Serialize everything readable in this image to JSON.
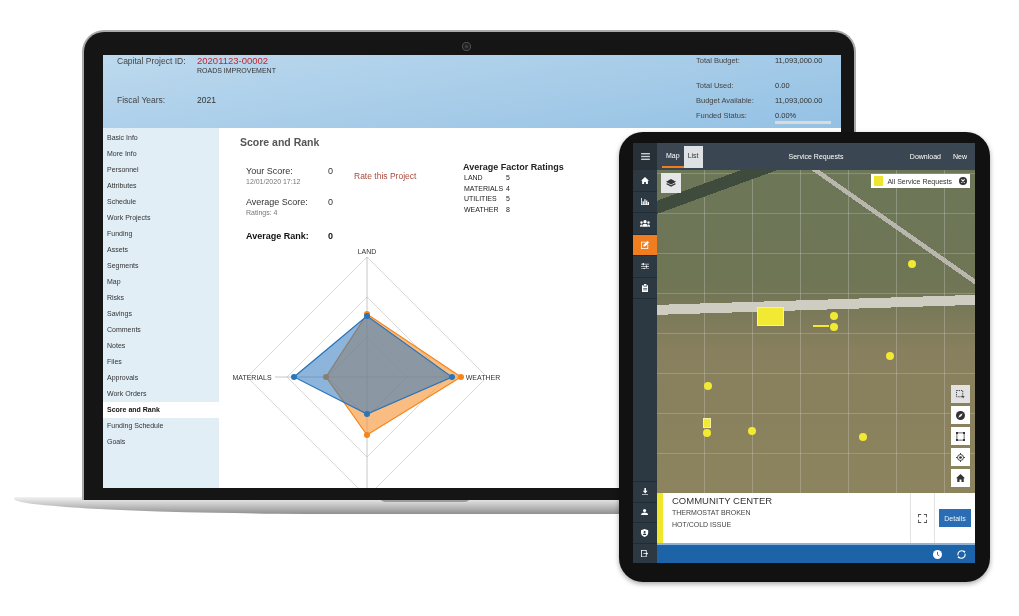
{
  "laptop": {
    "header": {
      "project_id_label": "Capital Project ID:",
      "project_id": "20201123-00002",
      "project_name": "ROADS IMPROVEMENT",
      "fiscal_years_label": "Fiscal Years:",
      "fiscal_years": "2021",
      "budget": [
        {
          "label": "Total Budget:",
          "value": "11,093,000.00"
        },
        {
          "label": "Total Used:",
          "value": "0.00"
        },
        {
          "label": "Budget Available:",
          "value": "11,093,000.00"
        },
        {
          "label": "Funded Status:",
          "value": "0.00%"
        }
      ],
      "funded_bar": {
        "level": 0
      }
    },
    "sidebar": {
      "items": [
        {
          "label": "Basic Info",
          "selected": false
        },
        {
          "label": "More Info",
          "selected": false
        },
        {
          "label": "Personnel",
          "selected": false
        },
        {
          "label": "Attributes",
          "selected": false
        },
        {
          "label": "Schedule",
          "selected": false
        },
        {
          "label": "Work Projects",
          "selected": false
        },
        {
          "label": "Funding",
          "selected": false
        },
        {
          "label": "Assets",
          "selected": false
        },
        {
          "label": "Segments",
          "selected": false
        },
        {
          "label": "Map",
          "selected": false
        },
        {
          "label": "Risks",
          "selected": false
        },
        {
          "label": "Savings",
          "selected": false
        },
        {
          "label": "Comments",
          "selected": false
        },
        {
          "label": "Notes",
          "selected": false
        },
        {
          "label": "Files",
          "selected": false
        },
        {
          "label": "Approvals",
          "selected": false
        },
        {
          "label": "Work Orders",
          "selected": false
        },
        {
          "label": "Score and Rank",
          "selected": true
        },
        {
          "label": "Funding Schedule",
          "selected": false
        },
        {
          "label": "Goals",
          "selected": false
        }
      ]
    },
    "score_panel": {
      "title": "Score and Rank",
      "your_score": {
        "label": "Your Score:",
        "value": "0",
        "note": "12/01/2020 17:12"
      },
      "rate_link": "Rate this Project",
      "average_score": {
        "label": "Average Score:",
        "value": "0",
        "note": "Ratings: 4"
      },
      "average_rank": {
        "label": "Average Rank:",
        "value": "0"
      },
      "factor_ratings": {
        "title": "Average Factor Ratings",
        "rows": [
          {
            "name": "LAND",
            "value": "5"
          },
          {
            "name": "MATERIALS",
            "value": "4"
          },
          {
            "name": "UTILITIES",
            "value": "5"
          },
          {
            "name": "WEATHER",
            "value": "8"
          }
        ]
      },
      "radar_chart": {
        "axis_labels": [
          "LAND",
          "MATERIALS",
          "WEATHER"
        ]
      }
    }
  },
  "tablet": {
    "nav": [
      {
        "selected": false
      },
      {
        "selected": false
      },
      {
        "selected": false
      },
      {
        "selected": true
      },
      {
        "selected": false
      },
      {
        "selected": false
      }
    ],
    "tabs": [
      {
        "label": "Map",
        "selected": true
      },
      {
        "label": "List",
        "selected": false
      }
    ],
    "title": "Service Requests",
    "actions": [
      "Download",
      "New"
    ],
    "legend": {
      "label": "All Service Requests"
    },
    "card": {
      "title": "COMMUNITY CENTER",
      "lines": [
        "THERMOSTAT BROKEN",
        "HOT/COLD ISSUE"
      ],
      "button": "Details"
    }
  }
}
